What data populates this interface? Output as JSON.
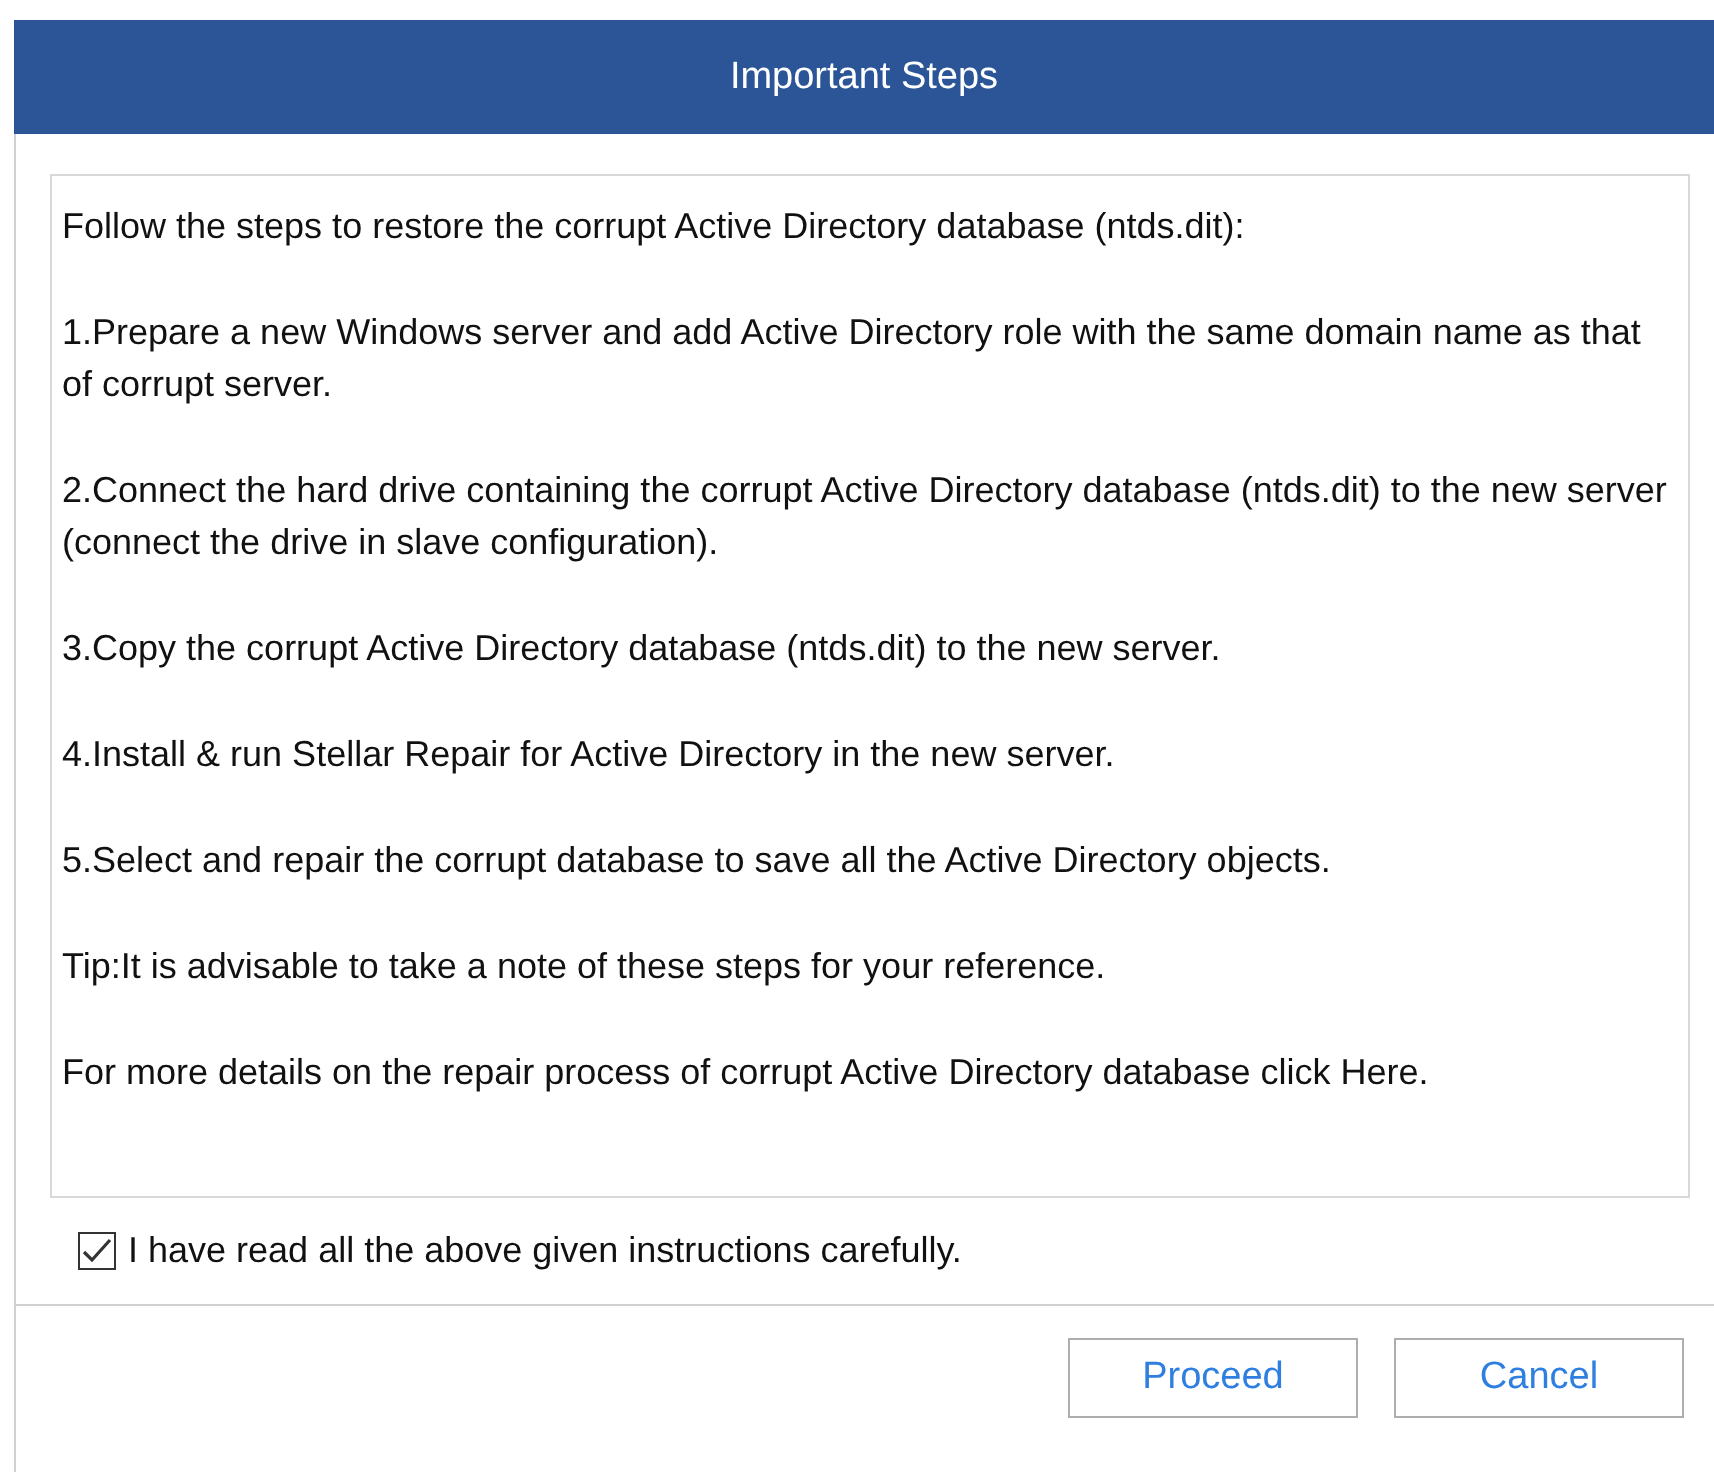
{
  "window": {
    "title": "Important Steps"
  },
  "paragraphs": [
    "Follow the steps to restore the corrupt Active Directory database (ntds.dit):",
    "1.Prepare a new Windows server and add Active Directory role with the same domain name as that of corrupt server.",
    "2.Connect the hard drive containing the corrupt Active Directory database (ntds.dit) to the new server (connect the drive in slave configuration).",
    "3.Copy the corrupt Active Directory database (ntds.dit) to the new server.",
    "4.Install & run Stellar Repair for Active Directory in the new server.",
    "5.Select and repair the corrupt database to save all the Active Directory objects.",
    "Tip:It is advisable to take a note of these steps for your reference.",
    "For more details on the repair process of corrupt Active Directory database click Here."
  ],
  "agreement": {
    "label": "I have read all the above given instructions carefully.",
    "checked": true
  },
  "buttons": [
    {
      "label": "Proceed"
    },
    {
      "label": "Cancel"
    }
  ]
}
